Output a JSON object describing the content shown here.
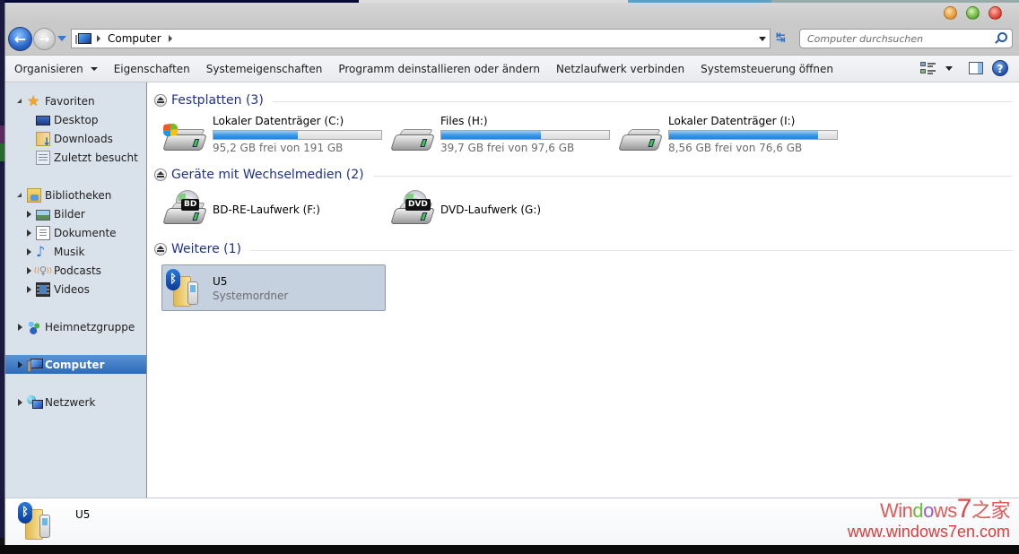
{
  "window": {
    "controls": {
      "minimize": "minimize",
      "maximize": "maximize",
      "close": "close"
    }
  },
  "navigation": {
    "back_icon": "arrow-left-icon",
    "forward_icon": "arrow-right-icon",
    "back_glyph": "←",
    "forward_glyph": "→",
    "address": {
      "breadcrumbs": [
        "Computer"
      ]
    },
    "refresh_glyph": "↹",
    "search": {
      "placeholder": "Computer durchsuchen",
      "value": ""
    }
  },
  "toolbar": {
    "items": [
      {
        "label": "Organisieren",
        "has_dropdown": true
      },
      {
        "label": "Eigenschaften"
      },
      {
        "label": "Systemeigenschaften"
      },
      {
        "label": "Programm deinstallieren oder ändern"
      },
      {
        "label": "Netzlaufwerk verbinden"
      },
      {
        "label": "Systemsteuerung öffnen"
      }
    ],
    "help_glyph": "?"
  },
  "sidebar": {
    "items": [
      {
        "label": "Favoriten",
        "icon": "star-icon",
        "level": 0,
        "state": "expanded"
      },
      {
        "label": "Desktop",
        "icon": "desktop-icon",
        "level": 1
      },
      {
        "label": "Downloads",
        "icon": "downloads-folder-icon",
        "level": 1
      },
      {
        "label": "Zuletzt besucht",
        "icon": "recent-places-icon",
        "level": 1
      },
      {
        "label": "Bibliotheken",
        "icon": "libraries-icon",
        "level": 0,
        "state": "expanded"
      },
      {
        "label": "Bilder",
        "icon": "pictures-icon",
        "level": 1,
        "state": "collapsed"
      },
      {
        "label": "Dokumente",
        "icon": "documents-icon",
        "level": 1,
        "state": "collapsed"
      },
      {
        "label": "Musik",
        "icon": "music-icon",
        "level": 1,
        "state": "collapsed"
      },
      {
        "label": "Podcasts",
        "icon": "podcasts-icon",
        "level": 1,
        "state": "collapsed"
      },
      {
        "label": "Videos",
        "icon": "videos-icon",
        "level": 1,
        "state": "collapsed"
      },
      {
        "label": "Heimnetzgruppe",
        "icon": "homegroup-icon",
        "level": 0,
        "state": "collapsed"
      },
      {
        "label": "Computer",
        "icon": "computer-icon",
        "level": 0,
        "state": "collapsed",
        "selected": true
      },
      {
        "label": "Netzwerk",
        "icon": "network-icon",
        "level": 0,
        "state": "collapsed"
      }
    ],
    "star_glyph": "★",
    "music_glyph": "♪",
    "podcast_glyph": "🎙"
  },
  "content": {
    "groups": [
      {
        "title": "Festplatten (3)",
        "drives": [
          {
            "name": "Lokaler Datenträger (C:)",
            "space": "95,2 GB frei von 191 GB",
            "used_fraction": 0.502,
            "icon": "system-drive-icon"
          },
          {
            "name": "Files (H:)",
            "space": "39,7 GB frei von 97,6 GB",
            "used_fraction": 0.593,
            "icon": "hard-drive-icon"
          },
          {
            "name": "Lokaler Datenträger (I:)",
            "space": "8,56 GB frei von 76,6 GB",
            "used_fraction": 0.888,
            "icon": "hard-drive-icon"
          }
        ]
      },
      {
        "title": "Geräte mit Wechselmedien (2)",
        "drives": [
          {
            "name": "BD-RE-Laufwerk (F:)",
            "media": "BD",
            "icon": "bluray-drive-icon"
          },
          {
            "name": "DVD-Laufwerk (G:)",
            "media": "DVD",
            "icon": "dvd-drive-icon"
          }
        ]
      },
      {
        "title": "Weitere (1)",
        "items": [
          {
            "name": "U5",
            "type": "Systemordner",
            "icon": "bluetooth-phone-folder-icon",
            "selected": true
          }
        ]
      }
    ]
  },
  "details_pane": {
    "name": "U5",
    "bt_glyph": "ᛒ"
  },
  "watermark": {
    "line1_prefix": "Win",
    "line1_d": "d",
    "line1_o": "o",
    "line1_ws": "ws",
    "line1_seven": "7",
    "line1_cn": "之家",
    "line2": "www.windows7en.com"
  },
  "colors": {
    "group_title": "#1e3287",
    "selection_blue": "#2d6ab8",
    "bar_fill": "#3e9be8",
    "sidebar_bg": "#d9e1ea"
  }
}
